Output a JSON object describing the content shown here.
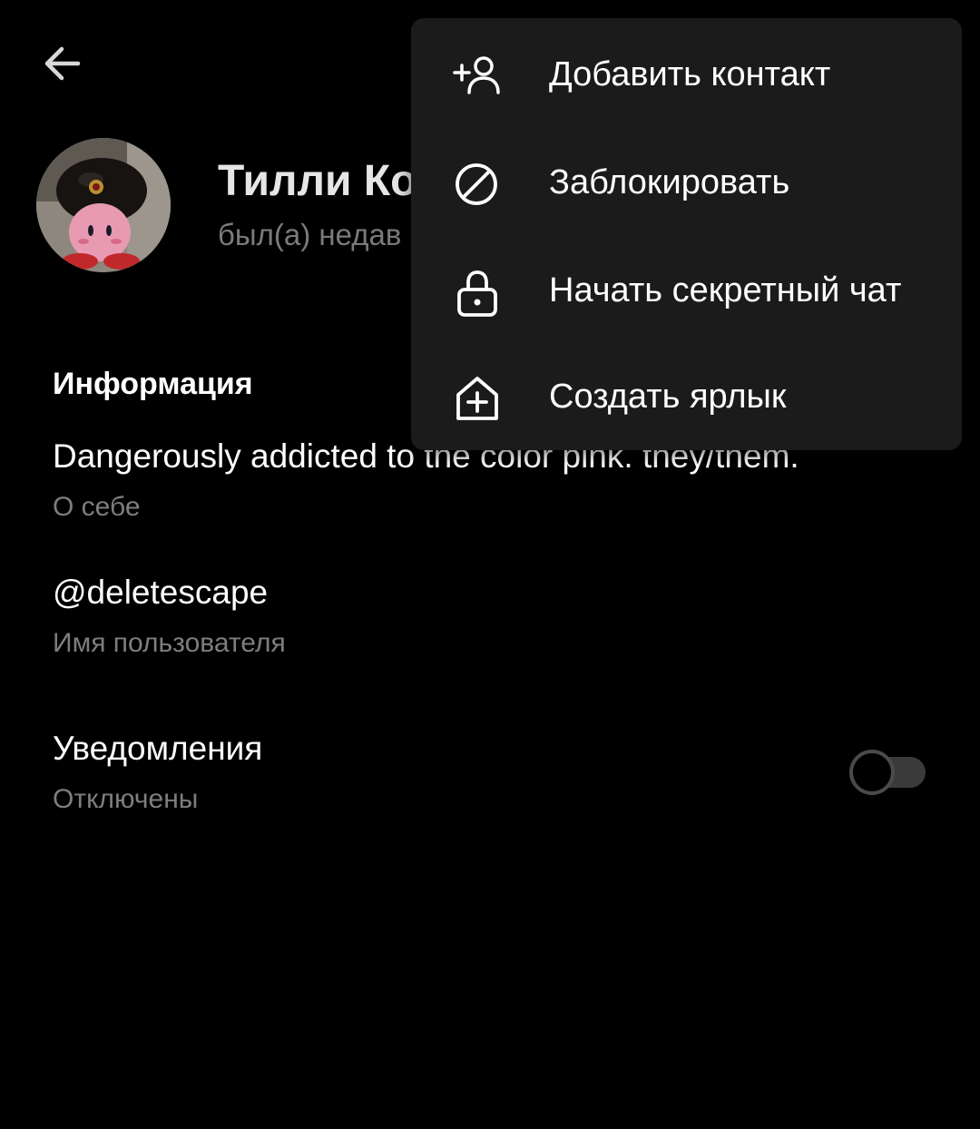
{
  "header": {
    "back_icon": "arrow-left-icon",
    "call_icon": "phone-icon",
    "more_icon": "more-vertical-icon"
  },
  "profile": {
    "name": "Тилли Ко",
    "status": "был(а) недав",
    "avatar": "avatar-photo"
  },
  "fab": {
    "icon": "message-icon"
  },
  "info": {
    "section_title": "Информация",
    "bio": "Dangerously addicted to the color pink. they/them.",
    "bio_caption": "О себе",
    "username": "@deletescape",
    "username_caption": "Имя пользователя",
    "notifications": "Уведомления",
    "notifications_caption": "Отключены",
    "notifications_enabled": false
  },
  "menu": {
    "items": [
      {
        "label": "Добавить контакт",
        "icon": "add-person-icon"
      },
      {
        "label": "Заблокировать",
        "icon": "block-icon"
      },
      {
        "label": "Начать секретный чат",
        "icon": "lock-icon"
      },
      {
        "label": "Создать ярлык",
        "icon": "add-home-icon"
      }
    ]
  },
  "colors": {
    "background": "#000000",
    "menu_background": "#1b1b1b",
    "secondary_text": "#7d7d7d"
  }
}
